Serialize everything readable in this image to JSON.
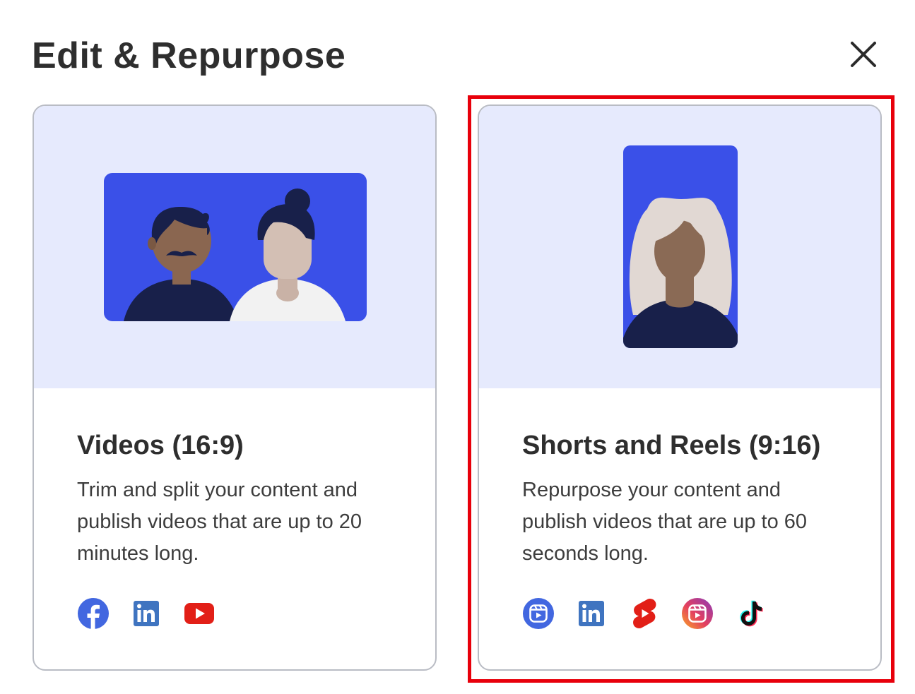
{
  "dialog": {
    "title": "Edit & Repurpose",
    "close_icon": "close-icon"
  },
  "cards": [
    {
      "title": "Videos (16:9)",
      "description": "Trim and split your content and publish videos that are up to 20 minutes long.",
      "platform_icons": [
        "facebook-icon",
        "linkedin-icon",
        "youtube-icon"
      ]
    },
    {
      "title": "Shorts and Reels (9:16)",
      "description": "Repurpose your content and publish videos that are up to 60 seconds long.",
      "platform_icons": [
        "facebook-reels-icon",
        "linkedin-icon",
        "youtube-shorts-icon",
        "instagram-reels-icon",
        "tiktok-icon"
      ],
      "selected": true
    }
  ],
  "colors": {
    "hero_background": "#e6eafd",
    "illustration_blue": "#3a50e8",
    "selection_outline": "#e8000b",
    "card_border": "#b9bcc4"
  }
}
